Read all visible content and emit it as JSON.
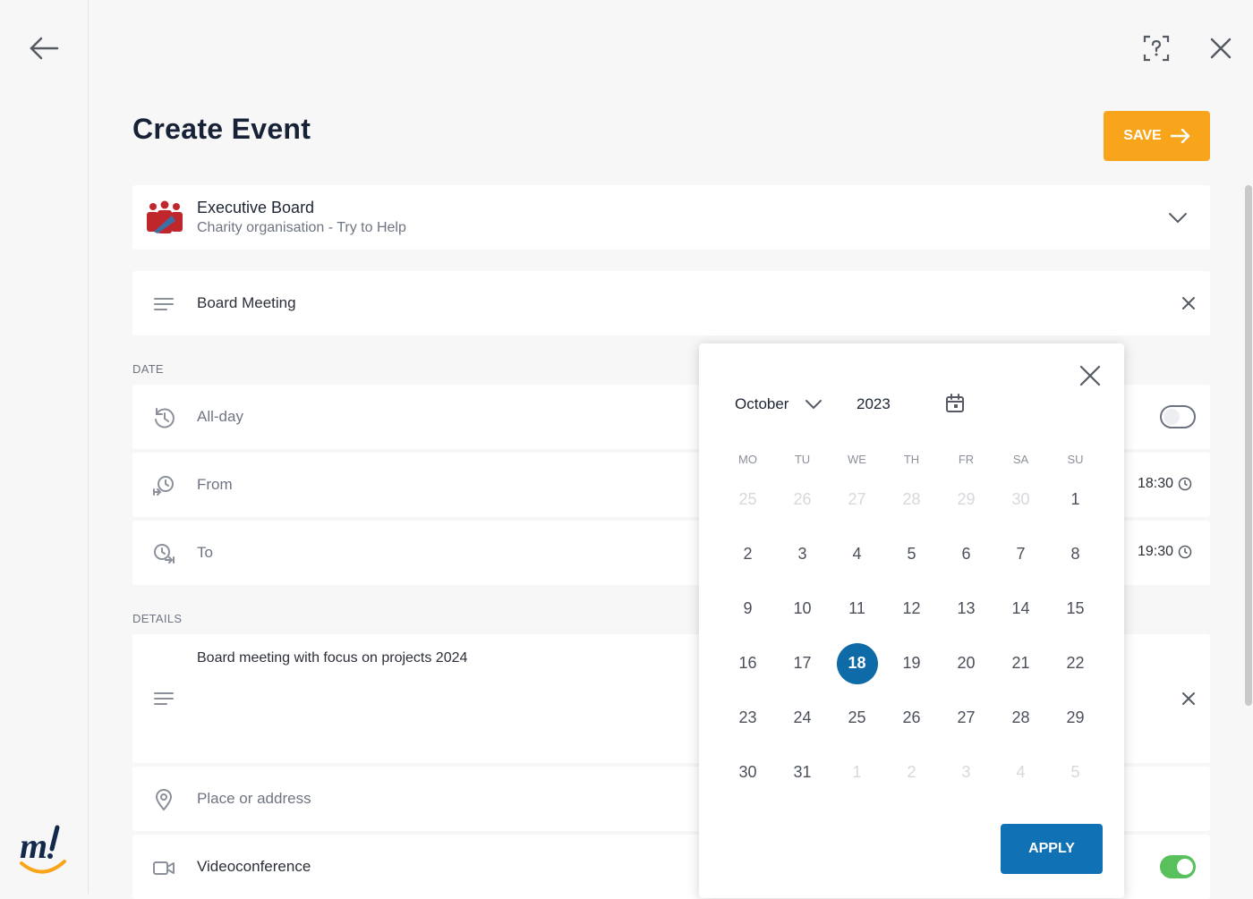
{
  "header": {
    "title": "Create Event",
    "save_label": "SAVE"
  },
  "organization": {
    "name": "Executive Board",
    "subtitle": "Charity organisation - Try to Help"
  },
  "title_field": {
    "value": "Board Meeting"
  },
  "sections": {
    "date": "DATE",
    "details": "DETAILS"
  },
  "date": {
    "allday_label": "All-day",
    "allday_on": false,
    "from_label": "From",
    "from_time": "18:30",
    "to_label": "To",
    "to_time": "19:30"
  },
  "details": {
    "description": "Board meeting with focus on projects 2024",
    "place_placeholder": "Place or address",
    "video_label": "Videoconference",
    "video_on": true
  },
  "picker": {
    "month": "October",
    "year": "2023",
    "weekdays": [
      "MO",
      "TU",
      "WE",
      "TH",
      "FR",
      "SA",
      "SU"
    ],
    "days": [
      {
        "d": "25",
        "m": true
      },
      {
        "d": "26",
        "m": true
      },
      {
        "d": "27",
        "m": true
      },
      {
        "d": "28",
        "m": true
      },
      {
        "d": "29",
        "m": true
      },
      {
        "d": "30",
        "m": true
      },
      {
        "d": "1"
      },
      {
        "d": "2"
      },
      {
        "d": "3"
      },
      {
        "d": "4"
      },
      {
        "d": "5"
      },
      {
        "d": "6"
      },
      {
        "d": "7"
      },
      {
        "d": "8"
      },
      {
        "d": "9"
      },
      {
        "d": "10"
      },
      {
        "d": "11"
      },
      {
        "d": "12"
      },
      {
        "d": "13"
      },
      {
        "d": "14"
      },
      {
        "d": "15"
      },
      {
        "d": "16"
      },
      {
        "d": "17"
      },
      {
        "d": "18",
        "sel": true
      },
      {
        "d": "19"
      },
      {
        "d": "20"
      },
      {
        "d": "21"
      },
      {
        "d": "22"
      },
      {
        "d": "23"
      },
      {
        "d": "24"
      },
      {
        "d": "25"
      },
      {
        "d": "26"
      },
      {
        "d": "27"
      },
      {
        "d": "28"
      },
      {
        "d": "29"
      },
      {
        "d": "30"
      },
      {
        "d": "31"
      },
      {
        "d": "1",
        "m": true
      },
      {
        "d": "2",
        "m": true
      },
      {
        "d": "3",
        "m": true
      },
      {
        "d": "4",
        "m": true
      },
      {
        "d": "5",
        "m": true
      }
    ],
    "apply_label": "APPLY"
  },
  "colors": {
    "save": "#f9a51b",
    "apply": "#1071b5",
    "selected": "#0f6aa8",
    "toggle_on": "#58c05d"
  }
}
